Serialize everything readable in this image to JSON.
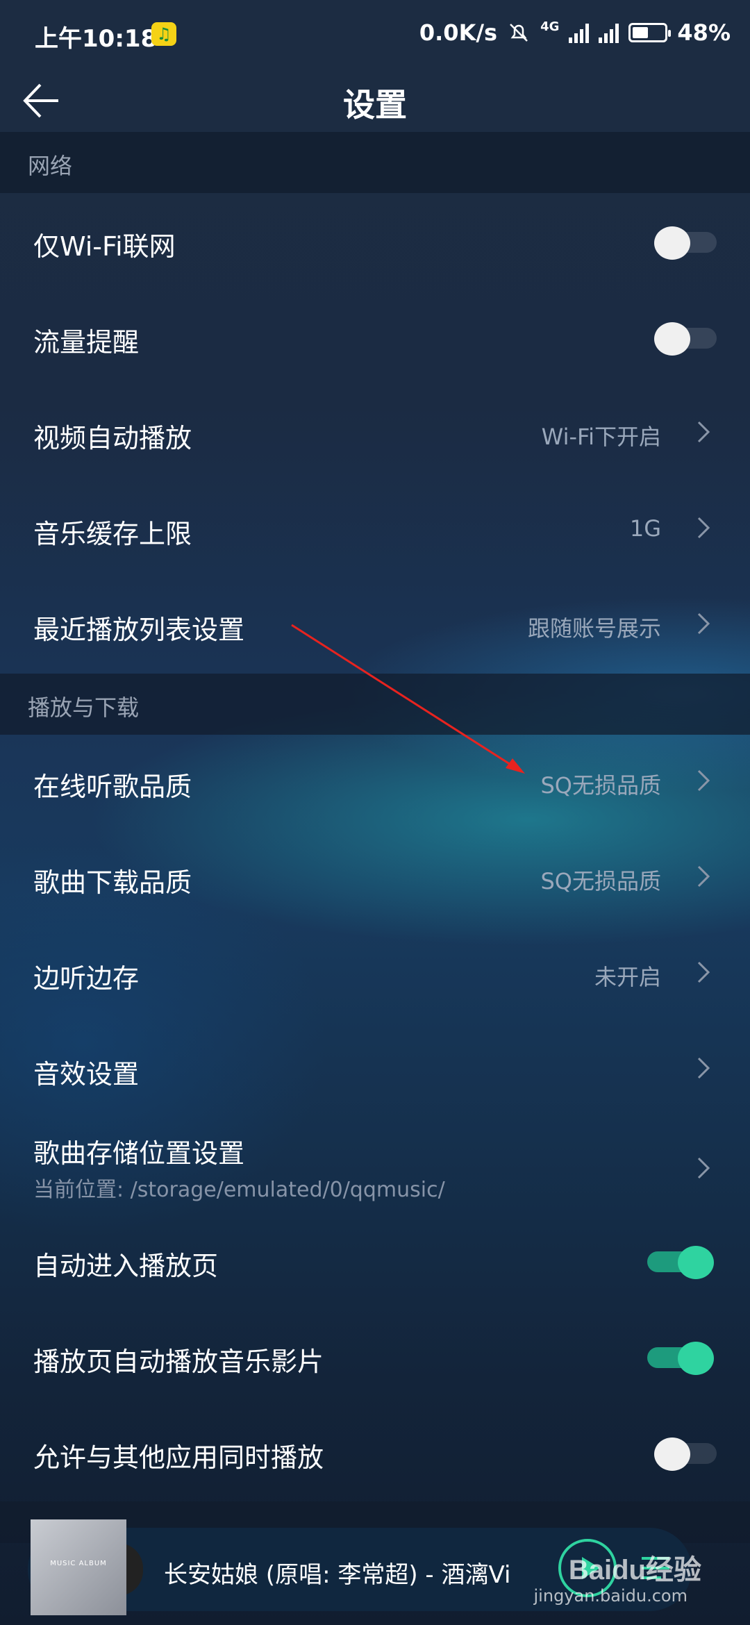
{
  "status_bar": {
    "time": "上午10:18",
    "net_speed": "0.0K/s",
    "network": "4G",
    "battery": "48%",
    "battery_level": 0.48
  },
  "header": {
    "title": "设置"
  },
  "sections": {
    "network": {
      "title": "网络",
      "wifi_only": "仅Wi-Fi联网",
      "data_alert": "流量提醒",
      "video_autoplay": "视频自动播放",
      "video_autoplay_value": "Wi-Fi下开启",
      "cache_limit": "音乐缓存上限",
      "cache_limit_value": "1G",
      "recent_list": "最近播放列表设置",
      "recent_list_value": "跟随账号展示"
    },
    "playback": {
      "title": "播放与下载",
      "online_quality": "在线听歌品质",
      "online_quality_value": "SQ无损品质",
      "download_quality": "歌曲下载品质",
      "download_quality_value": "SQ无损品质",
      "listen_save": "边听边存",
      "listen_save_value": "未开启",
      "sound_effects": "音效设置",
      "storage_location": "歌曲存储位置设置",
      "storage_location_sub": "当前位置: /storage/emulated/0/qqmusic/",
      "auto_enter_player": "自动进入播放页",
      "auto_play_video": "播放页自动播放音乐影片",
      "allow_concurrent": "允许与其他应用同时播放"
    }
  },
  "toggles": {
    "wifi_only": false,
    "data_alert": false,
    "auto_enter_player": true,
    "auto_play_video": true,
    "allow_concurrent": false
  },
  "mini_player": {
    "album_label": "MUSIC ALBUM",
    "song": "长安姑娘 (原唱: 李常超) - 酒漓Vi"
  },
  "watermark": {
    "brand": "Baidu经验",
    "url": "jingyan.baidu.com"
  },
  "colors": {
    "accent": "#2fd3a0",
    "annotation_arrow": "#e8231f"
  }
}
